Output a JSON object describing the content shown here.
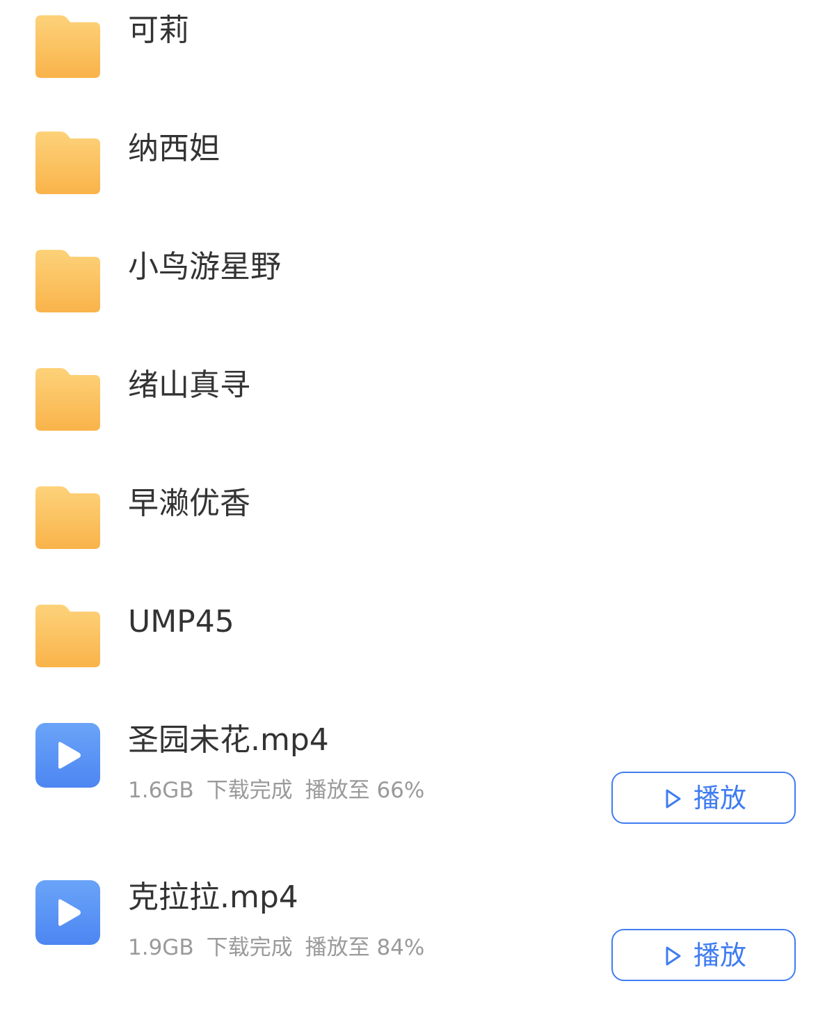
{
  "colors": {
    "folder": "#fbbd52",
    "video_icon": "#5a93f5",
    "accent": "#3f7cf0",
    "title_text": "#333333",
    "meta_text": "#9a9a9a"
  },
  "folders": [
    {
      "name": "可莉",
      "icon": "folder-icon"
    },
    {
      "name": "纳西妲",
      "icon": "folder-icon"
    },
    {
      "name": "小鸟游星野",
      "icon": "folder-icon"
    },
    {
      "name": "绪山真寻",
      "icon": "folder-icon"
    },
    {
      "name": "早濑优香",
      "icon": "folder-icon"
    },
    {
      "name": "UMP45",
      "icon": "folder-icon"
    }
  ],
  "files": [
    {
      "name": "圣园未花.mp4",
      "icon": "video-play-icon",
      "size": "1.6GB",
      "status": "下载完成",
      "progress": "播放至 66%",
      "progress_fraction": 0.66,
      "button_label": "播放"
    },
    {
      "name": "克拉拉.mp4",
      "icon": "video-play-icon",
      "size": "1.9GB",
      "status": "下载完成",
      "progress": "播放至 84%",
      "progress_fraction": 0.84,
      "button_label": "播放"
    }
  ]
}
